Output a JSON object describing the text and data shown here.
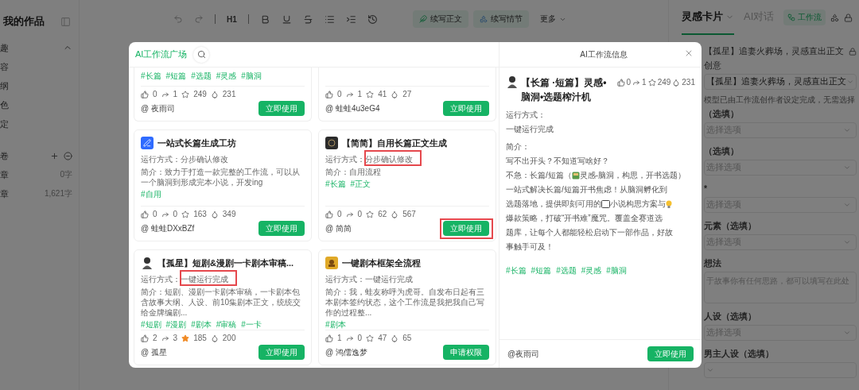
{
  "sidebar": {
    "title": "我的作品",
    "items": [
      "趣",
      "容",
      "纲",
      "色",
      "定"
    ],
    "volume": {
      "label": "卷"
    },
    "chapters": [
      {
        "label": "章",
        "count": "0字"
      },
      {
        "label": "章",
        "count": "1,621字"
      }
    ]
  },
  "editor_toolbar": {
    "heading": "H1",
    "actions": [
      "续写正文",
      "续写情节",
      "更多"
    ]
  },
  "right_panel": {
    "tabs": [
      {
        "label": "灵感卡片",
        "selected": true
      },
      {
        "label": "AI对话",
        "selected": false
      }
    ],
    "workflow_button": "工作流",
    "workflow_name": "【孤星】追妻火葬场，灵感直出正文",
    "fields": [
      {
        "kind": "select",
        "label": "创意",
        "value": "【孤星】追妻火葬场，灵感直出正文",
        "hint": "模型已由工作流创作者设定完成，无需选择"
      },
      {
        "kind": "select",
        "label": "（选填）",
        "placeholder": "选择选项"
      },
      {
        "kind": "select",
        "label": "（选填）",
        "placeholder": "选择选项"
      },
      {
        "kind": "select",
        "label": "*",
        "placeholder": "选择选项"
      },
      {
        "kind": "select",
        "label": "元素（选填）",
        "placeholder": "选择选项"
      },
      {
        "kind": "textarea",
        "label": "想法",
        "placeholder": "于故事你有任何思路，都可以填写在此处"
      },
      {
        "kind": "select",
        "label": "人设（选填）",
        "placeholder": "选择选项"
      },
      {
        "kind": "select",
        "label": "男主人设（选填）"
      }
    ]
  },
  "modal": {
    "title": "AI工作流广场",
    "detail_title": "AI工作流信息",
    "cards": [
      {
        "tags": [
          "#长篇",
          "#短篇",
          "#选题",
          "#灵感",
          "#脑洞"
        ],
        "stats": {
          "likes": "0",
          "shares": "1",
          "stars": "249",
          "uses": "231",
          "favorited": false
        },
        "author": "@ 夜雨司",
        "button": "立即使用",
        "button_marked": false
      },
      {
        "stats": {
          "likes": "0",
          "shares": "1",
          "stars": "41",
          "uses": "27",
          "favorited": false
        },
        "author": "@ 蛙蛙4u3eG4",
        "button": "立即使用",
        "button_marked": false
      },
      {
        "title": "一站式长篇生成工坊",
        "mode": "运行方式：分步确认修改",
        "intro": "简介：致力于打造一款完整的工作流，可以从一个脑洞到形成完本小说，开发ing",
        "tags": [
          "#自用"
        ],
        "stats": {
          "likes": "0",
          "shares": "0",
          "stars": "163",
          "uses": "349",
          "favorited": false
        },
        "author": "@ 蛙蛙DXxBZf",
        "button": "立即使用",
        "mode_marked": false,
        "button_marked": false
      },
      {
        "title": "【简简】自用长篇正文生成",
        "mode": "运行方式：分步确认修改",
        "intro": "简介：自用流程",
        "tags": [
          "#长篇",
          "#正文"
        ],
        "stats": {
          "likes": "0",
          "shares": "0",
          "stars": "62",
          "uses": "567",
          "favorited": false
        },
        "author": "@ 简简",
        "button": "立即使用",
        "mode_marked": true,
        "button_marked": true
      },
      {
        "title": "【孤星】短剧&漫剧一卡剧本审稿...",
        "mode": "运行方式：一键运行完成",
        "intro": "简介：短剧、漫剧一卡剧本审稿，一卡剧本包含故事大纲、人设、前10集剧本正文，统统交给金牌编剧...",
        "tags": [
          "#短剧",
          "#漫剧",
          "#剧本",
          "#审稿",
          "#一卡"
        ],
        "stats": {
          "likes": "2",
          "shares": "3",
          "stars": "185",
          "uses": "200",
          "favorited": true
        },
        "author": "@ 孤星",
        "button": "立即使用",
        "mode_marked": true,
        "button_marked": false
      },
      {
        "title": "一键剧本框架全流程",
        "mode": "运行方式：一键运行完成",
        "intro": "简介：我，蛙友称呼为虎哥。自发布日起有三本剧本签约状态，这个工作流是我把我自己写作的过程整...",
        "tags": [
          "#剧本"
        ],
        "stats": {
          "likes": "1",
          "shares": "0",
          "stars": "47",
          "uses": "65",
          "favorited": false
        },
        "author": "@ 鸿儒逸梦",
        "button": "申请权限",
        "mode_marked": false,
        "button_marked": false
      }
    ],
    "detail": {
      "title": "【长篇 ·短篇】灵感•脑洞•选题榨汁机",
      "stats": {
        "likes": "0",
        "shares": "1",
        "stars": "249",
        "uses": "231",
        "favorited": false
      },
      "mode_label": "运行方式：",
      "mode": "一键运行完成",
      "intro_label": "简介：",
      "lines": [
        [
          {
            "kind": "text",
            "text": "写不出开头？不知道写啥好？"
          }
        ],
        [
          {
            "kind": "text",
            "text": "不急：长篇/短篇（"
          },
          {
            "kind": "note"
          },
          {
            "kind": "text",
            "text": "灵感-脑洞，构思，开书选题）"
          }
        ],
        [
          {
            "kind": "text",
            "text": "一站式解决长篇/短篇开书焦虑！从脑洞孵化到"
          }
        ],
        [
          {
            "kind": "text",
            "text": "选题落地，提供即刻可用的"
          },
          {
            "kind": "book"
          },
          {
            "kind": "text",
            "text": "小说构思方案与"
          },
          {
            "kind": "bulb"
          }
        ],
        [
          {
            "kind": "text",
            "text": "爆款策略，打破“开书难”魔咒。覆盖全赛道选"
          }
        ],
        [
          {
            "kind": "text",
            "text": "题库，让每个人都能轻松启动下一部作品，好故"
          }
        ],
        [
          {
            "kind": "text",
            "text": "事触手可及！"
          }
        ]
      ],
      "tags": [
        "#长篇",
        "#短篇",
        "#选题",
        "#灵感",
        "#脑洞"
      ],
      "author": "@夜雨司",
      "button": "立即使用"
    }
  }
}
